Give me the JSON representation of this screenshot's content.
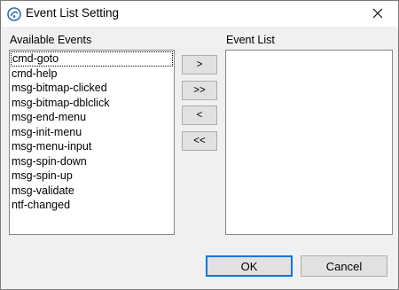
{
  "window": {
    "title": "Event List Setting"
  },
  "available": {
    "label": "Available Events",
    "items": [
      "cmd-goto",
      "cmd-help",
      "msg-bitmap-clicked",
      "msg-bitmap-dblclick",
      "msg-end-menu",
      "msg-init-menu",
      "msg-menu-input",
      "msg-spin-down",
      "msg-spin-up",
      "msg-validate",
      "ntf-changed"
    ]
  },
  "event_list": {
    "label": "Event List",
    "items": []
  },
  "move_buttons": {
    "add": ">",
    "add_all": ">>",
    "remove": "<",
    "remove_all": "<<"
  },
  "dialog_buttons": {
    "ok": "OK",
    "cancel": "Cancel"
  },
  "colors": {
    "accent": "#0078d7",
    "window_bg": "#f0f0f0",
    "button_bg": "#e1e1e1"
  }
}
